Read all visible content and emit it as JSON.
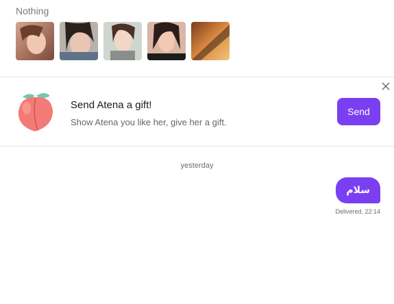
{
  "profile": {
    "label": "Nothing",
    "photos": [
      {
        "name": "photo-1"
      },
      {
        "name": "photo-2"
      },
      {
        "name": "photo-3"
      },
      {
        "name": "photo-4"
      },
      {
        "name": "photo-5"
      }
    ]
  },
  "gift_card": {
    "icon": "peach-icon",
    "title": "Send Atena a gift!",
    "subtitle": "Show Atena you like her, give her a gift.",
    "send_label": "Send",
    "close_icon": "close-icon"
  },
  "chat": {
    "date_separator": "yesterday",
    "messages": [
      {
        "text": "سلام",
        "status": "Delivered, 22:14",
        "outgoing": true
      }
    ]
  },
  "colors": {
    "accent": "#7b3ff2",
    "divider": "#e4e4e4"
  }
}
